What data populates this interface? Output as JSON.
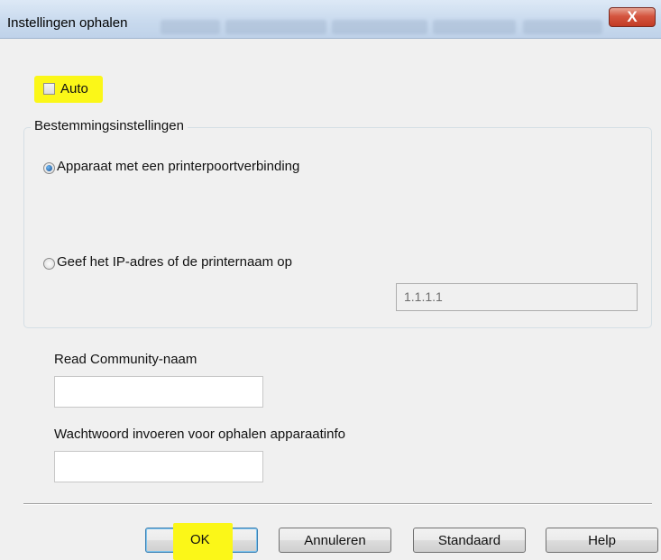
{
  "window": {
    "title": "Instellingen ophalen",
    "close_glyph": "X"
  },
  "auto": {
    "label": "Auto",
    "checked": false
  },
  "destination": {
    "group_label": "Bestemmingsinstellingen",
    "options": [
      {
        "label": "Apparaat met een printerpoortverbinding",
        "selected": true
      },
      {
        "label": "Geef het IP-adres of de printernaam op",
        "selected": false
      }
    ],
    "ip_value": "1.1.1.1"
  },
  "community": {
    "label": "Read Community-naam",
    "value": ""
  },
  "password": {
    "label": "Wachtwoord invoeren voor ophalen apparaatinfo",
    "value": ""
  },
  "buttons": {
    "ok": "OK",
    "cancel": "Annuleren",
    "default": "Standaard",
    "help": "Help"
  },
  "colors": {
    "highlight": "#fbf718",
    "title_bar": "#c9daee",
    "close_button": "#c23b25"
  }
}
